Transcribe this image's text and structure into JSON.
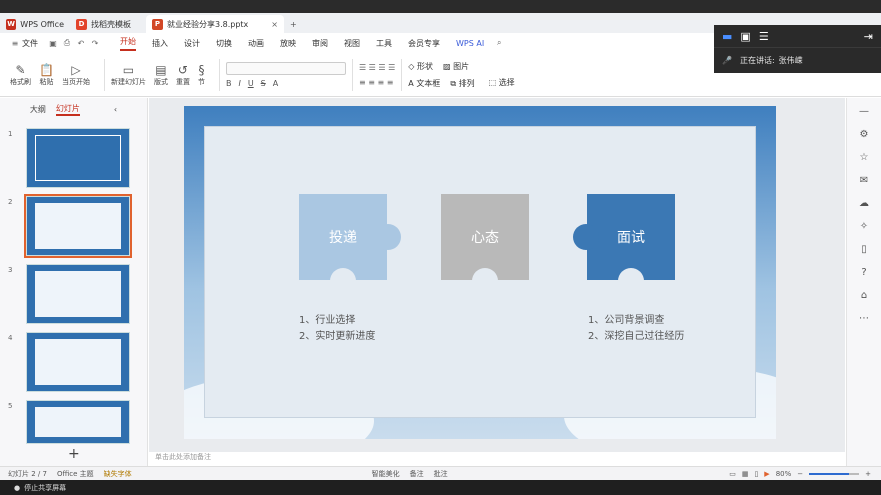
{
  "tabs": [
    {
      "label": "WPS Office",
      "logo": "W",
      "color": "#c52f1e"
    },
    {
      "label": "找稻壳模板",
      "logo": "D",
      "color": "#e2432b"
    },
    {
      "label": "就业经验分享3.8.pptx",
      "logo": "P",
      "color": "#d24726"
    }
  ],
  "menu": {
    "file": "文件",
    "items": [
      "开始",
      "插入",
      "设计",
      "切换",
      "动画",
      "放映",
      "审阅",
      "视图",
      "工具",
      "会员专享"
    ],
    "ai": "WPS AI"
  },
  "toolbar": {
    "format_painter": "格式刷",
    "paste": "粘贴",
    "current_start": "当页开始",
    "new_slide": "新建幻灯片",
    "layout": "版式",
    "section": "节",
    "reset": "重置",
    "shape": "形状",
    "picture": "图片",
    "textbox": "文本框",
    "arrange": "排列",
    "select": "选择"
  },
  "overlay": {
    "speaking_label": "正在讲话:",
    "speaker": "张伟嵘"
  },
  "left_panel": {
    "outline": "大纲",
    "slides": "幻灯片",
    "slide_numbers": [
      "1",
      "2",
      "3",
      "4",
      "5"
    ]
  },
  "slide": {
    "pieces": [
      {
        "label": "投递",
        "color": "#aac7e2"
      },
      {
        "label": "心态",
        "color": "#b9b9b9"
      },
      {
        "label": "面试",
        "color": "#3b78b4"
      }
    ],
    "left_items": [
      "1、行业选择",
      "2、实时更新进度"
    ],
    "right_items": [
      "1、公司背景调查",
      "2、深挖自己过往经历"
    ]
  },
  "notes_placeholder": "单击此处添加备注",
  "status": {
    "page": "幻灯片 2 / 7",
    "theme": "Office 主题",
    "missing_font": "缺失字体",
    "beautify": "智能美化",
    "notes": "备注",
    "comments": "批注",
    "zoom": "80%"
  },
  "zoom_fraction": 0.8,
  "share": {
    "label": "停止共享屏幕"
  }
}
